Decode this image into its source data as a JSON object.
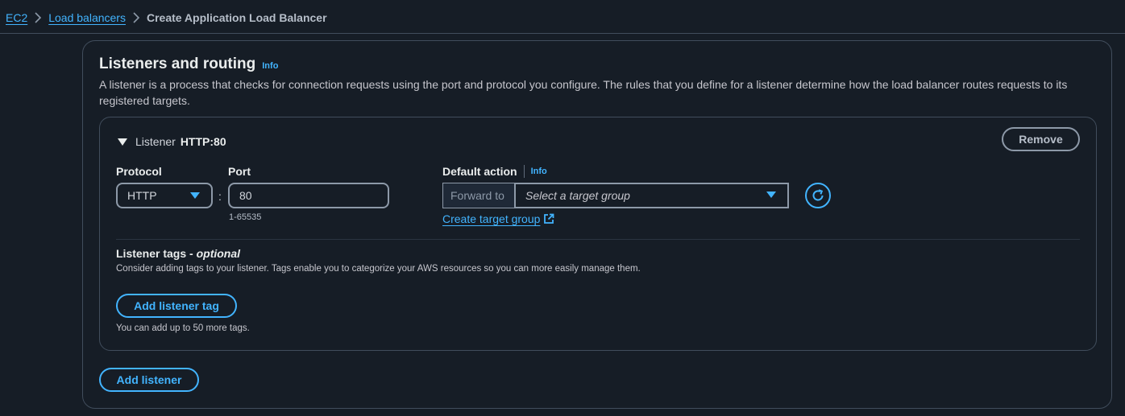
{
  "breadcrumb": {
    "items": [
      "EC2",
      "Load balancers"
    ],
    "current": "Create Application Load Balancer"
  },
  "section": {
    "title": "Listeners and routing",
    "info": "Info",
    "description": "A listener is a process that checks for connection requests using the port and protocol you configure. The rules that you define for a listener determine how the load balancer routes requests to its registered targets."
  },
  "listener": {
    "label": "Listener",
    "name": "HTTP:80",
    "remove_label": "Remove",
    "protocol_label": "Protocol",
    "protocol_value": "HTTP",
    "colon": ":",
    "port_label": "Port",
    "port_value": "80",
    "port_hint": "1-65535",
    "default_action_label": "Default action",
    "default_action_info": "Info",
    "forward_to": "Forward to",
    "target_group_placeholder": "Select a target group",
    "create_target_group": "Create target group",
    "tags_title": "Listener tags - ",
    "tags_optional": "optional",
    "tags_description": "Consider adding tags to your listener. Tags enable you to categorize your AWS resources so you can more easily manage them.",
    "add_tag_label": "Add listener tag",
    "tags_note": "You can add up to 50 more tags."
  },
  "add_listener_label": "Add listener",
  "colors": {
    "background": "#161d26",
    "accent": "#42b4ff",
    "border": "#414d5c"
  },
  "icons": [
    "chevron-right-icon",
    "caret-down-icon",
    "dropdown-arrow-icon",
    "refresh-icon",
    "external-link-icon"
  ]
}
